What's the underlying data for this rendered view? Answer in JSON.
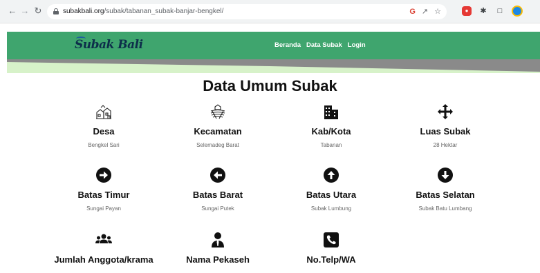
{
  "browser": {
    "url_host": "subakbali.org",
    "url_path": "/subak/tabanan_subak-banjar-bengkel/",
    "nav_back_icon": "arrow-left-icon",
    "nav_forward_icon": "arrow-right-icon",
    "reload_icon": "reload-icon",
    "omnibox_icons": [
      "google-lens-icon",
      "share-icon",
      "star-icon"
    ],
    "toolbar_icons": [
      "extension-red-icon",
      "puzzle-extensions-icon",
      "side-panel-icon",
      "profile-avatar-icon"
    ]
  },
  "header": {
    "logo_text": "Subak Bali",
    "menu": [
      "Beranda",
      "Data Subak",
      "Login"
    ],
    "color_green": "#3fa56e",
    "color_gray": "#8a8a8a",
    "color_lightgreen": "#d7f2c9"
  },
  "main": {
    "title": "Data Umum Subak",
    "cards": [
      {
        "icon": "village-icon",
        "label": "Desa",
        "value": "Bengkel Sari"
      },
      {
        "icon": "farm-field-icon",
        "label": "Kecamatan",
        "value": "Selemadeg Barat"
      },
      {
        "icon": "city-buildings-icon",
        "label": "Kab/Kota",
        "value": "Tabanan"
      },
      {
        "icon": "arrows-move-icon",
        "label": "Luas Subak",
        "value": "28 Hektar"
      },
      {
        "icon": "arrow-circle-right-icon",
        "label": "Batas Timur",
        "value": "Sungai Payan"
      },
      {
        "icon": "arrow-circle-left-icon",
        "label": "Batas Barat",
        "value": "Sungai Putek"
      },
      {
        "icon": "arrow-circle-up-icon",
        "label": "Batas Utara",
        "value": "Subak Lumbung"
      },
      {
        "icon": "arrow-circle-down-icon",
        "label": "Batas Selatan",
        "value": "Subak Batu Lumbang"
      },
      {
        "icon": "users-group-icon",
        "label": "Jumlah Anggota/krama"
      },
      {
        "icon": "user-tie-icon",
        "label": "Nama Pekaseh"
      },
      {
        "icon": "phone-square-icon",
        "label": "No.Telp/WA"
      }
    ]
  }
}
